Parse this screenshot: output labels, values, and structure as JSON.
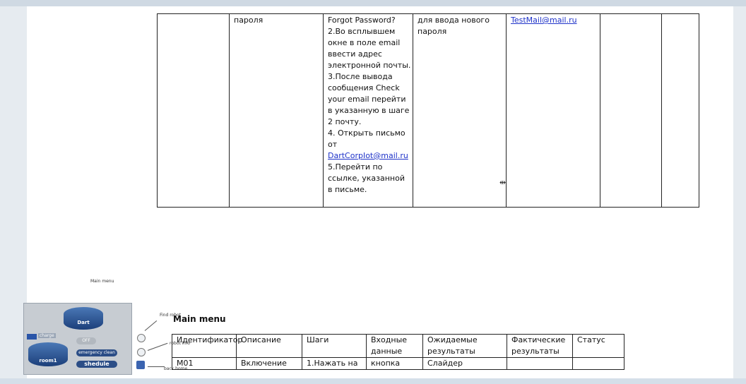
{
  "table1": {
    "cells": {
      "col2": "пароля",
      "steps": [
        "Forgot Password?",
        "2.Во всплывшем",
        "окне в поле email",
        "ввести адрес",
        "электронной почты.",
        "3.После вывода",
        "сообщения Check",
        "your email перейти",
        "в указанную в шаге",
        "2 почту.",
        "4. Открыть письмо",
        "от"
      ],
      "steps_link": "DartCorpIot@mail.ru",
      "steps_tail": [
        "5.Перейти по",
        "ссылке, указанной",
        "в письме."
      ],
      "col4": [
        "для ввода нового",
        "пароля"
      ],
      "col5_link": "TestMail@mail.ru"
    }
  },
  "diagram": {
    "title": "Main menu",
    "labels": {
      "find_robot": "Find robot",
      "robot_info": "robot info",
      "back_home": "back home"
    },
    "cyl_top": "Dart",
    "cyl_bottom": "room1",
    "off": "OFF",
    "emergency": "emergency clean",
    "schedule": "shedule",
    "charge": "charge"
  },
  "section_heading": "Main menu",
  "table2": {
    "headers": [
      "Идентификатор",
      "Описание",
      "Шаги",
      "Входные данные",
      "Ожидаемые результаты",
      "Фактические результаты",
      "Статус"
    ],
    "row1": [
      "M01",
      "Включение",
      "1.Нажать на",
      "кнопка",
      "Слайдер",
      "",
      ""
    ]
  }
}
